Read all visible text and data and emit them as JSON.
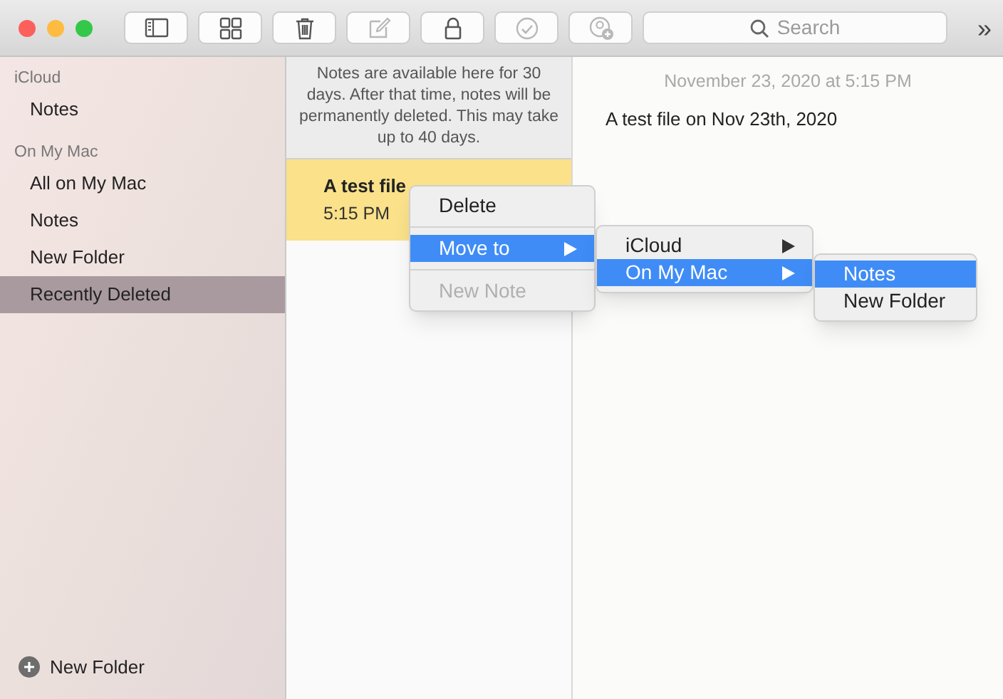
{
  "toolbar": {
    "buttons": [
      {
        "kind": "sidebar",
        "disabled": false
      },
      {
        "kind": "grid",
        "disabled": false
      },
      {
        "kind": "trash",
        "disabled": false
      },
      {
        "kind": "compose",
        "disabled": true
      },
      {
        "kind": "lock",
        "disabled": false
      },
      {
        "kind": "check",
        "disabled": true
      },
      {
        "kind": "people",
        "disabled": true
      }
    ],
    "search": {
      "placeholder": "Search"
    },
    "overflow": "»"
  },
  "sidebar": {
    "sections": [
      {
        "header": "iCloud",
        "items": [
          {
            "label": "Notes",
            "selected": false
          }
        ]
      },
      {
        "header": "On My Mac",
        "items": [
          {
            "label": "All on My Mac",
            "selected": false
          },
          {
            "label": "Notes",
            "selected": false
          },
          {
            "label": "New Folder",
            "selected": false
          },
          {
            "label": "Recently Deleted",
            "selected": true
          }
        ]
      }
    ],
    "new_folder": "New Folder"
  },
  "note_list": {
    "notice": "Notes are available here for 30 days. After that time, notes will be permanently deleted. This may take up to 40 days.",
    "notes": [
      {
        "title": "A test file",
        "time": "5:15 PM",
        "selected": true
      }
    ]
  },
  "editor": {
    "date": "November 23, 2020 at 5:15 PM",
    "body": "A test file on Nov 23th, 2020"
  },
  "menus": [
    {
      "items": [
        {
          "label": "Delete",
          "selected": false,
          "disabled": false,
          "submenu": false
        },
        {
          "kind": "separator"
        },
        {
          "label": "Move to",
          "selected": true,
          "disabled": false,
          "submenu": true
        },
        {
          "kind": "separator"
        },
        {
          "label": "New Note",
          "selected": false,
          "disabled": true,
          "submenu": false
        }
      ]
    },
    {
      "items": [
        {
          "label": "iCloud",
          "selected": false,
          "disabled": false,
          "submenu": true
        },
        {
          "label": "On My Mac",
          "selected": true,
          "disabled": false,
          "submenu": true
        }
      ]
    },
    {
      "items": [
        {
          "label": "Notes",
          "selected": true,
          "disabled": false,
          "submenu": false
        },
        {
          "label": "New Folder",
          "selected": false,
          "disabled": false,
          "submenu": false
        }
      ]
    }
  ]
}
